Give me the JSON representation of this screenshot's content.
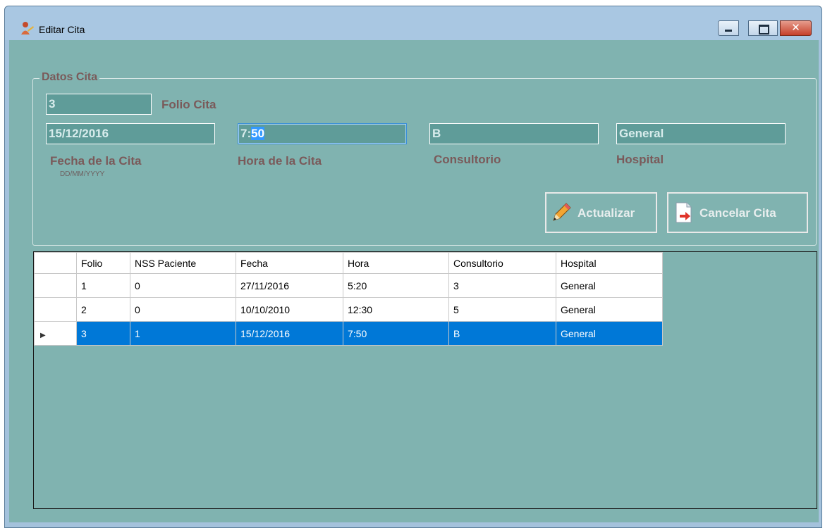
{
  "window": {
    "title": "Editar Cita",
    "close_glyph": "✕"
  },
  "group": {
    "legend": "Datos Cita"
  },
  "fields": {
    "folio": {
      "value": "3",
      "label": "Folio Cita"
    },
    "fecha": {
      "value": "15/12/2016",
      "label": "Fecha de la Cita",
      "hint": "DD/MM/YYYY"
    },
    "hora": {
      "value_prefix": "7:",
      "value_selected": "50",
      "label": "Hora de la Cita"
    },
    "consultorio": {
      "value": "B",
      "label": "Consultorio"
    },
    "hospital": {
      "value": "General",
      "label": "Hospital"
    }
  },
  "buttons": {
    "actualizar": {
      "label": "Actualizar",
      "icon": "pencil-icon"
    },
    "cancelar": {
      "label": "Cancelar Cita",
      "icon": "document-cancel-icon"
    }
  },
  "grid": {
    "columns": [
      "Folio",
      "NSS Paciente",
      "Fecha",
      "Hora",
      "Consultorio",
      "Hospital"
    ],
    "rows": [
      [
        "1",
        "0",
        "27/11/2016",
        "5:20",
        "3",
        "General"
      ],
      [
        "2",
        "0",
        "10/10/2010",
        "12:30",
        "5",
        "General"
      ],
      [
        "3",
        "1",
        "15/12/2016",
        "7:50",
        "B",
        "General"
      ]
    ],
    "selected_row": 2,
    "row_indicator": "▶"
  },
  "colors": {
    "client_background": "#80b3b0",
    "selection": "#0078d7",
    "label_text": "#7a5a5a"
  }
}
